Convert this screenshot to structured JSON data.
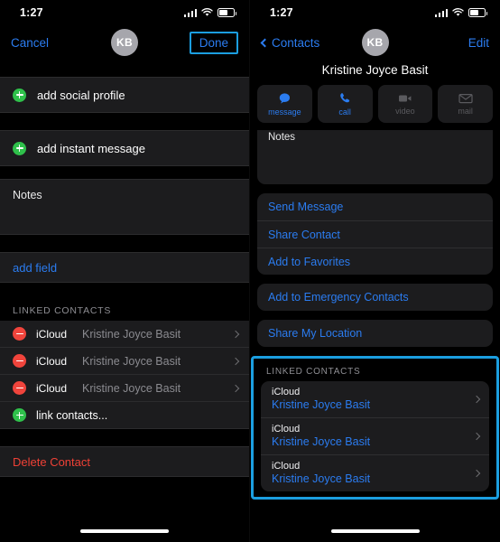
{
  "status_bar": {
    "time": "1:27",
    "signal_icon": "cellular-signal-icon",
    "wifi_icon": "wifi-icon",
    "battery_icon": "battery-icon"
  },
  "left_screen": {
    "nav": {
      "cancel_label": "Cancel",
      "done_label": "Done",
      "avatar_initials": "KB",
      "done_highlight_color": "#1b9ee0"
    },
    "rows": [
      {
        "label": "add social profile",
        "badge": "plus",
        "badge_color": "#2fc04b"
      },
      {
        "label": "add instant message",
        "badge": "plus",
        "badge_color": "#2fc04b"
      }
    ],
    "notes_label": "Notes",
    "add_field_label": "add field",
    "linked_contacts_header": "LINKED CONTACTS",
    "linked_contacts": [
      {
        "badge": "minus",
        "badge_color": "#f0443c",
        "source": "iCloud",
        "name": "Kristine Joyce Basit"
      },
      {
        "badge": "minus",
        "badge_color": "#f0443c",
        "source": "iCloud",
        "name": "Kristine  Joyce Basit"
      },
      {
        "badge": "minus",
        "badge_color": "#f0443c",
        "source": "iCloud",
        "name": "Kristine Joyce Basit"
      }
    ],
    "link_contacts_label": "link contacts...",
    "delete_contact_label": "Delete Contact",
    "delete_color": "#ef4136"
  },
  "right_screen": {
    "nav": {
      "back_label": "Contacts",
      "edit_label": "Edit",
      "avatar_initials": "KB"
    },
    "contact_name": "Kristine Joyce Basit",
    "actions": [
      {
        "label": "message",
        "icon": "message-bubble-icon",
        "enabled": true
      },
      {
        "label": "call",
        "icon": "phone-icon",
        "enabled": true
      },
      {
        "label": "video",
        "icon": "video-camera-icon",
        "enabled": false
      },
      {
        "label": "mail",
        "icon": "envelope-icon",
        "enabled": false
      }
    ],
    "notes_label": "Notes",
    "action_group_1": [
      "Send Message",
      "Share Contact",
      "Add to Favorites"
    ],
    "action_group_2": [
      "Add to Emergency Contacts"
    ],
    "action_group_3": [
      "Share My Location"
    ],
    "linked_contacts_header": "LINKED CONTACTS",
    "linked_contacts": [
      {
        "source": "iCloud",
        "name": "Kristine Joyce Basit"
      },
      {
        "source": "iCloud",
        "name": "Kristine  Joyce Basit"
      },
      {
        "source": "iCloud",
        "name": "Kristine Joyce Basit"
      }
    ],
    "highlight_color": "#1b9ee0",
    "link_color": "#2b7cf0"
  }
}
